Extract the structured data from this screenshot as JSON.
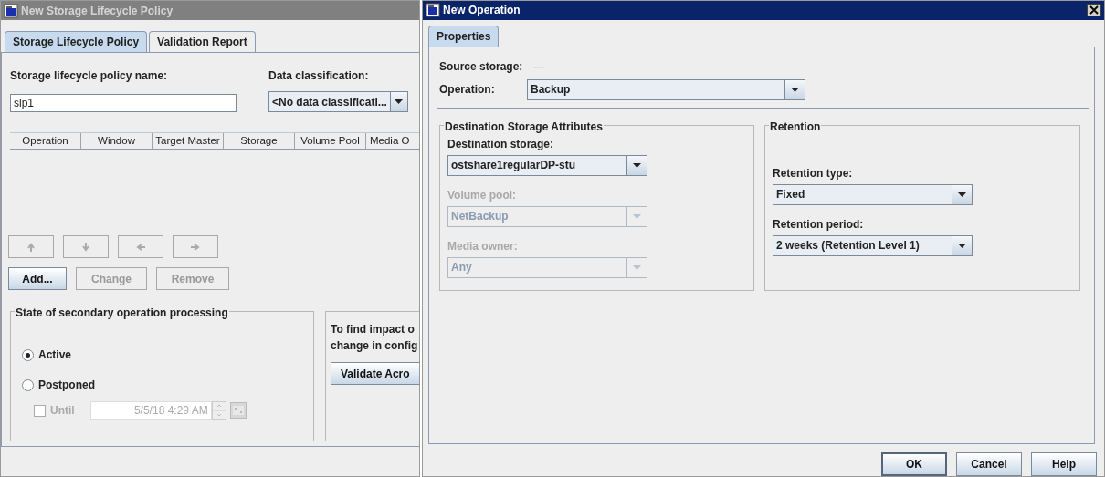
{
  "left_window": {
    "title": "New Storage Lifecycle Policy",
    "active": false,
    "tabs": [
      {
        "label": "Storage Lifecycle Policy",
        "selected": true
      },
      {
        "label": "Validation Report",
        "selected": false
      }
    ],
    "name_field": {
      "label": "Storage lifecycle policy name:",
      "value": "slp1"
    },
    "classification": {
      "label": "Data classification:",
      "value": "<No data classificati..."
    },
    "table": {
      "columns": [
        "Operation",
        "Window",
        "Target Master",
        "Storage",
        "Volume Pool",
        "Media O"
      ]
    },
    "arrow_buttons": [
      {
        "kind": "up",
        "disabled": true
      },
      {
        "kind": "down",
        "disabled": true
      },
      {
        "kind": "left",
        "disabled": true
      },
      {
        "kind": "right",
        "disabled": true
      }
    ],
    "buttons": [
      {
        "label": "Add...",
        "disabled": false
      },
      {
        "label": "Change",
        "disabled": true
      },
      {
        "label": "Remove",
        "disabled": true
      }
    ],
    "state_group": {
      "title": "State of secondary operation processing",
      "options": [
        {
          "label": "Active",
          "selected": true
        },
        {
          "label": "Postponed",
          "selected": false
        }
      ],
      "until": {
        "label": "Until",
        "checked": false,
        "disabled": true,
        "value": "5/5/18 4:29 AM"
      }
    },
    "validate_group": {
      "lines": [
        "To find impact o",
        "change in config"
      ],
      "button": "Validate Acro"
    }
  },
  "right_window": {
    "title": "New Operation",
    "active": true,
    "tabs": [
      {
        "label": "Properties",
        "selected": true
      }
    ],
    "source": {
      "label": "Source storage:",
      "value": "---"
    },
    "operation": {
      "label": "Operation:",
      "value": "Backup"
    },
    "destination": {
      "title": "Destination Storage Attributes",
      "fields": [
        {
          "label": "Destination storage:",
          "value": "ostshare1regularDP-stu",
          "disabled": false
        },
        {
          "label": "Volume pool:",
          "value": "NetBackup",
          "disabled": true
        },
        {
          "label": "Media owner:",
          "value": "Any",
          "disabled": true
        }
      ]
    },
    "retention": {
      "title": "Retention",
      "fields": [
        {
          "label": "Retention type:",
          "value": "Fixed",
          "disabled": false
        },
        {
          "label": "Retention period:",
          "value": "2 weeks (Retention Level 1)",
          "disabled": false
        }
      ]
    },
    "buttons": [
      {
        "label": "OK",
        "default": true
      },
      {
        "label": "Cancel",
        "default": false
      },
      {
        "label": "Help",
        "default": false
      }
    ]
  }
}
